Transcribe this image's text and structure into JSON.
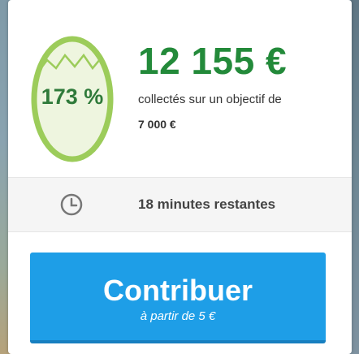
{
  "progress": {
    "percent_label": "173 %",
    "percent_value": 1.73,
    "amount": "12 155 €",
    "collected_text": "collectés sur un objectif de",
    "goal": "7 000 €"
  },
  "timer": {
    "remaining": "18 minutes restantes"
  },
  "cta": {
    "label": "Contribuer",
    "sublabel": "à partir de 5 €"
  },
  "colors": {
    "accent_green": "#238a3a",
    "egg_outline": "#9ccc5a",
    "button_blue": "#1e9ee7"
  },
  "icons": {
    "egg": "egg-icon",
    "clock": "clock-icon"
  }
}
